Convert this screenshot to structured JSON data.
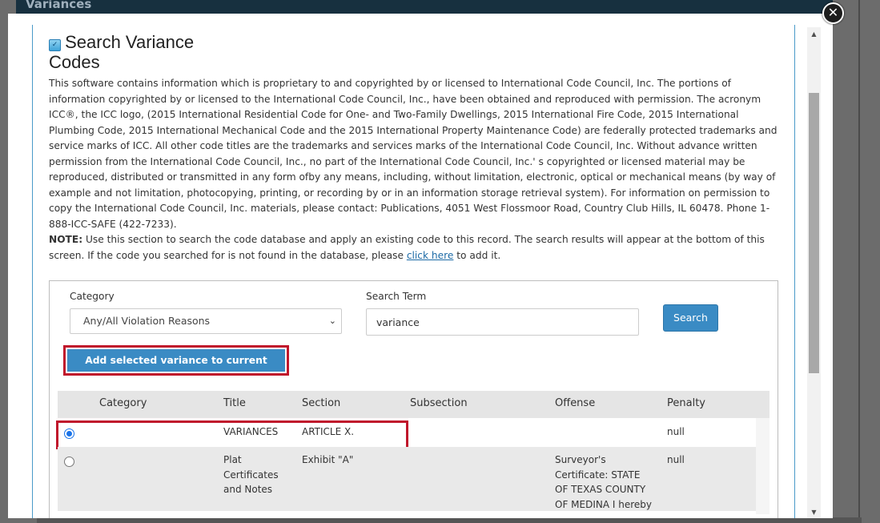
{
  "background": {
    "header_title": "Variances"
  },
  "modal": {
    "close_glyph": "✕",
    "title": "Search Variance Codes",
    "title_line1": "Search Variance",
    "title_line2": "Codes",
    "legal_text": "This software contains information which is proprietary to and copyrighted by or licensed to International Code Council, Inc. The portions of information copyrighted by or licensed to the International Code Council, Inc., have been obtained and reproduced with permission. The acronym ICC®, the ICC logo, (2015 International Residential Code for One- and Two-Family Dwellings, 2015 International Fire Code, 2015 International Plumbing Code, 2015 International Mechanical Code and the 2015 International Property Maintenance Code) are federally protected trademarks and service marks of ICC. All other code titles are the trademarks and services marks of the International Code Council, Inc. Without advance written permission from the International Code Council, Inc., no part of the International Code Council, Inc.' s copyrighted or licensed material may be reproduced, distributed or transmitted in any form ofby any means, including, without limitation, electronic, optical or mechanical means (by way of example and not limitation, photocopying, printing, or recording by or in an information storage retrieval system). For information on permission to copy the International Code Council, Inc. materials, please contact: Publications, 4051 West Flossmoor Road, Country Club Hills, IL 60478. Phone 1-888-ICC-SAFE (422-7233).",
    "note": {
      "label": "NOTE:",
      "text_before": " Use this section to search the code database and apply an existing code to this record. The search results will appear at the bottom of this screen. If the code you searched for is not found in the database, please ",
      "link": "click here",
      "text_after": " to add it."
    }
  },
  "search": {
    "category_label": "Category",
    "category_value": "Any/All Violation Reasons",
    "term_label": "Search Term",
    "term_value": "variance",
    "search_button": "Search",
    "add_button": "Add selected variance to current record"
  },
  "table": {
    "headers": [
      "Category",
      "Title",
      "Section",
      "Subsection",
      "Offense",
      "Penalty"
    ],
    "rows": [
      {
        "selected": true,
        "category": "",
        "title": "VARIANCES",
        "section": "ARTICLE X.",
        "subsection": "",
        "offense": "",
        "penalty": "null"
      },
      {
        "selected": false,
        "category": "",
        "title": "Plat Certificates and Notes",
        "section": "Exhibit \"A\"",
        "subsection": "",
        "offense": "Surveyor's Certificate: STATE OF TEXAS COUNTY OF MEDINA I hereby",
        "penalty": "null"
      }
    ]
  },
  "scrollbar": {
    "up_glyph": "▲",
    "down_glyph": "▼"
  },
  "colors": {
    "primary_button": "#3a8bc4",
    "highlight_border": "#c0152b",
    "link": "#1c6aa6"
  }
}
